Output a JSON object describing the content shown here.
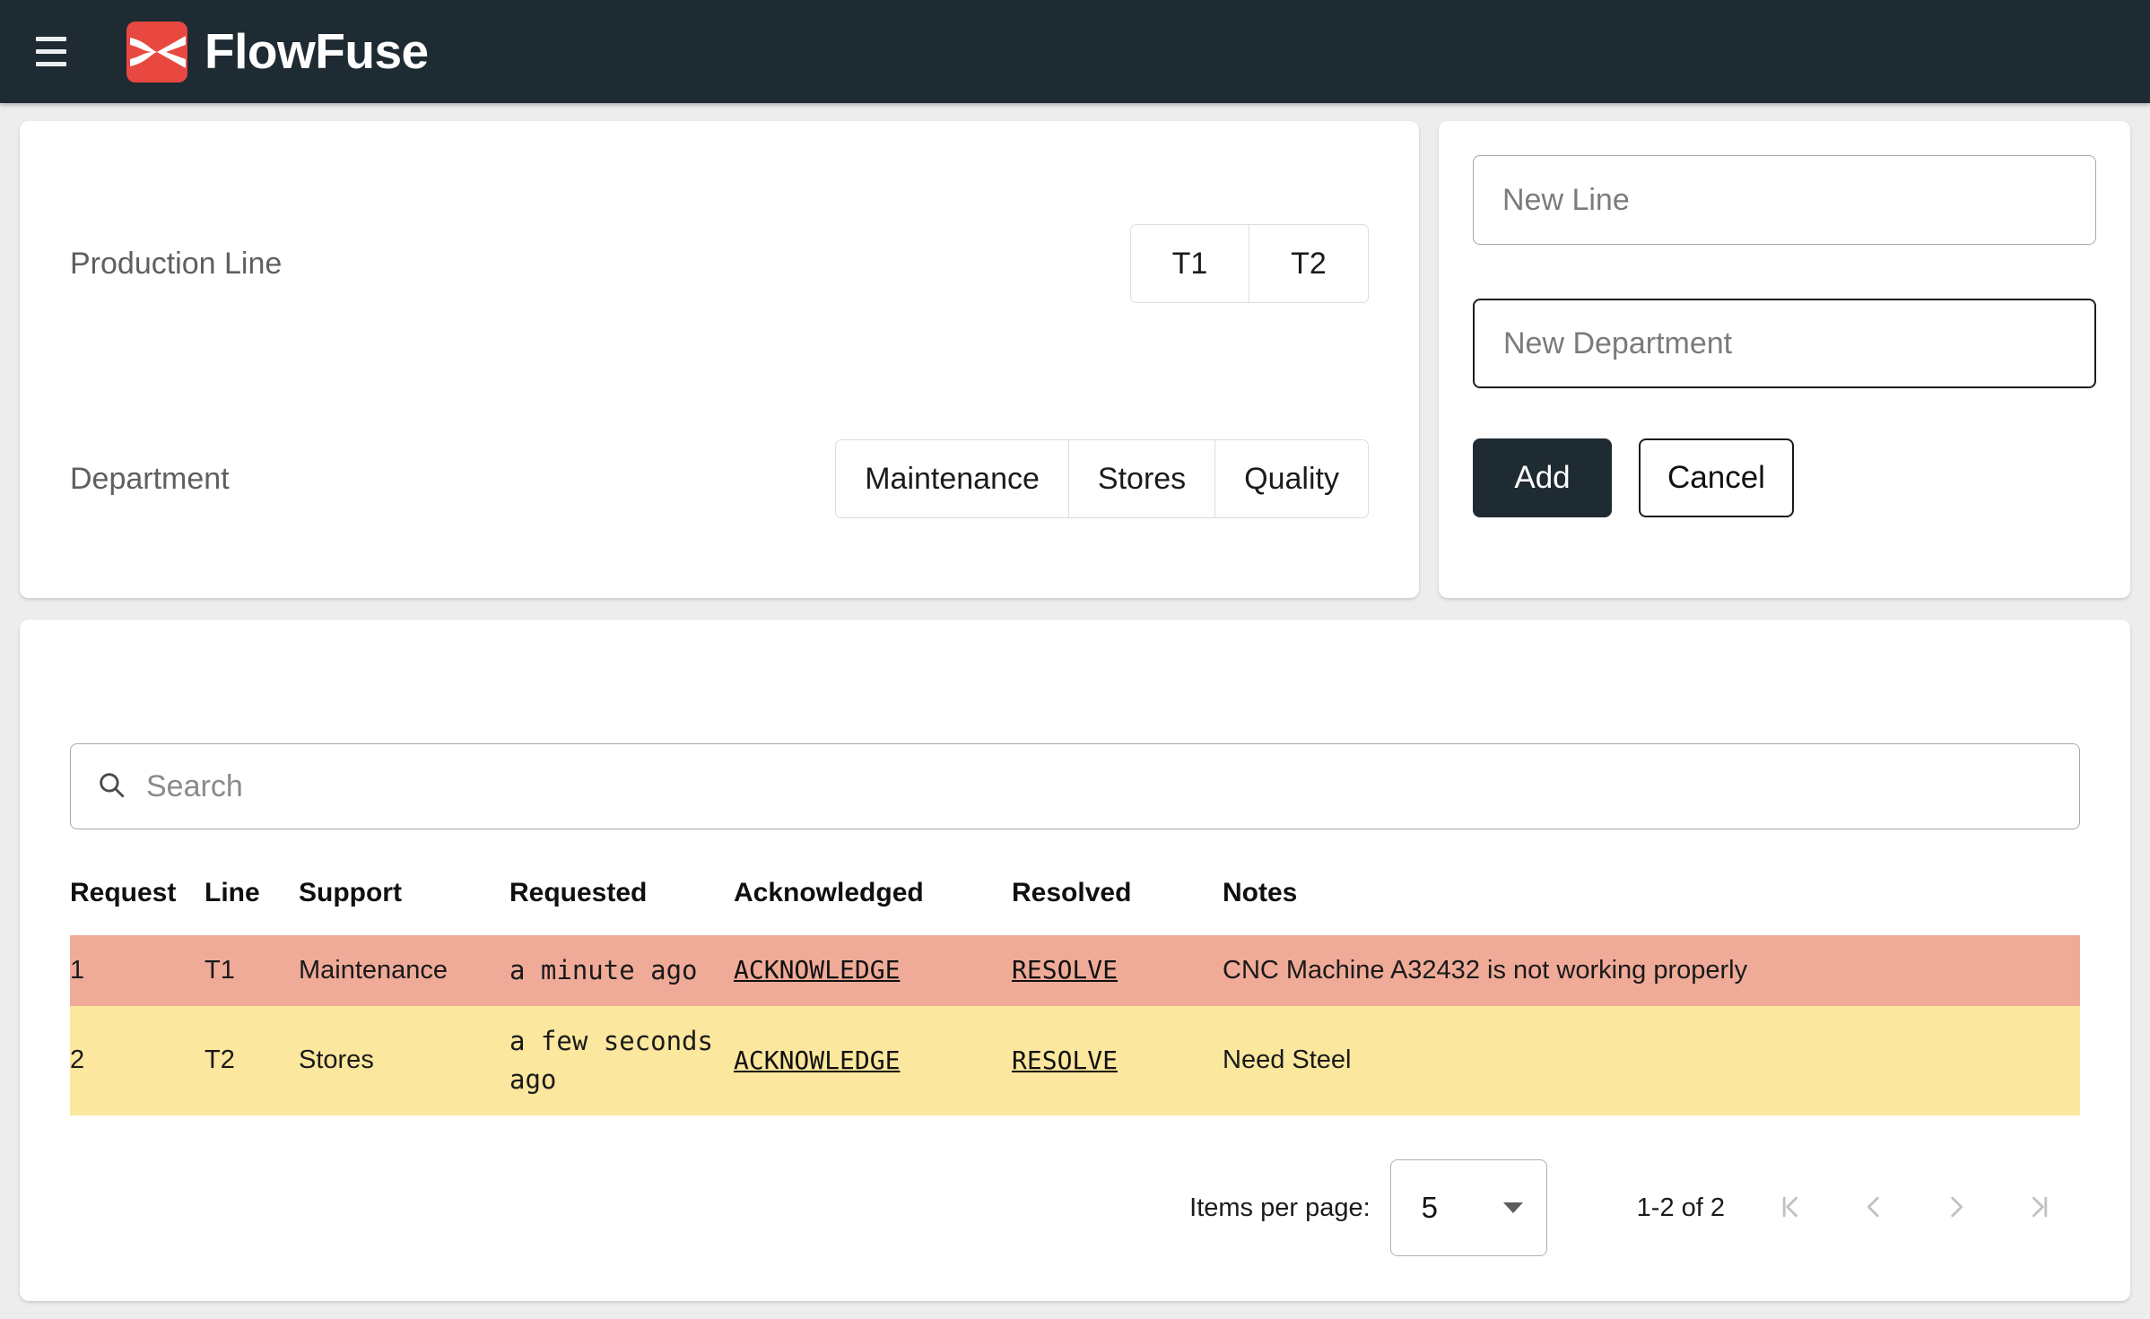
{
  "appbar": {
    "menu_icon": "hamburger-menu-icon",
    "logo_icon": "flowfuse-logo-icon",
    "title": "FlowFuse",
    "brand_color": "#e8483f",
    "bar_color": "#1f2b33"
  },
  "config_card": {
    "production_line": {
      "label": "Production Line",
      "options": [
        "T1",
        "T2"
      ]
    },
    "department": {
      "label": "Department",
      "options": [
        "Maintenance",
        "Stores",
        "Quality"
      ]
    }
  },
  "add_card": {
    "new_line": {
      "placeholder": "New Line",
      "value": ""
    },
    "new_department": {
      "placeholder": "New Department",
      "value": ""
    },
    "add_label": "Add",
    "cancel_label": "Cancel"
  },
  "requests_card": {
    "search": {
      "placeholder": "Search",
      "value": "",
      "icon": "search-icon"
    },
    "columns": [
      "Request",
      "Line",
      "Support",
      "Requested",
      "Acknowledged",
      "Resolved",
      "Notes"
    ],
    "rows": [
      {
        "request": "1",
        "line": "T1",
        "support": "Maintenance",
        "requested": "a minute ago",
        "acknowledge_label": "ACKNOWLEDGE",
        "resolve_label": "RESOLVE",
        "notes": "CNC Machine A32432 is not working properly",
        "status_color": "#efab98"
      },
      {
        "request": "2",
        "line": "T2",
        "support": "Stores",
        "requested": "a few seconds ago",
        "acknowledge_label": "ACKNOWLEDGE",
        "resolve_label": "RESOLVE",
        "notes": "Need Steel",
        "status_color": "#fbe79d"
      }
    ],
    "paginator": {
      "items_per_page_label": "Items per page:",
      "items_per_page_value": "5",
      "range_label": "1-2 of 2",
      "first_page_icon": "first-page-icon",
      "prev_page_icon": "previous-page-icon",
      "next_page_icon": "next-page-icon",
      "last_page_icon": "last-page-icon"
    }
  }
}
